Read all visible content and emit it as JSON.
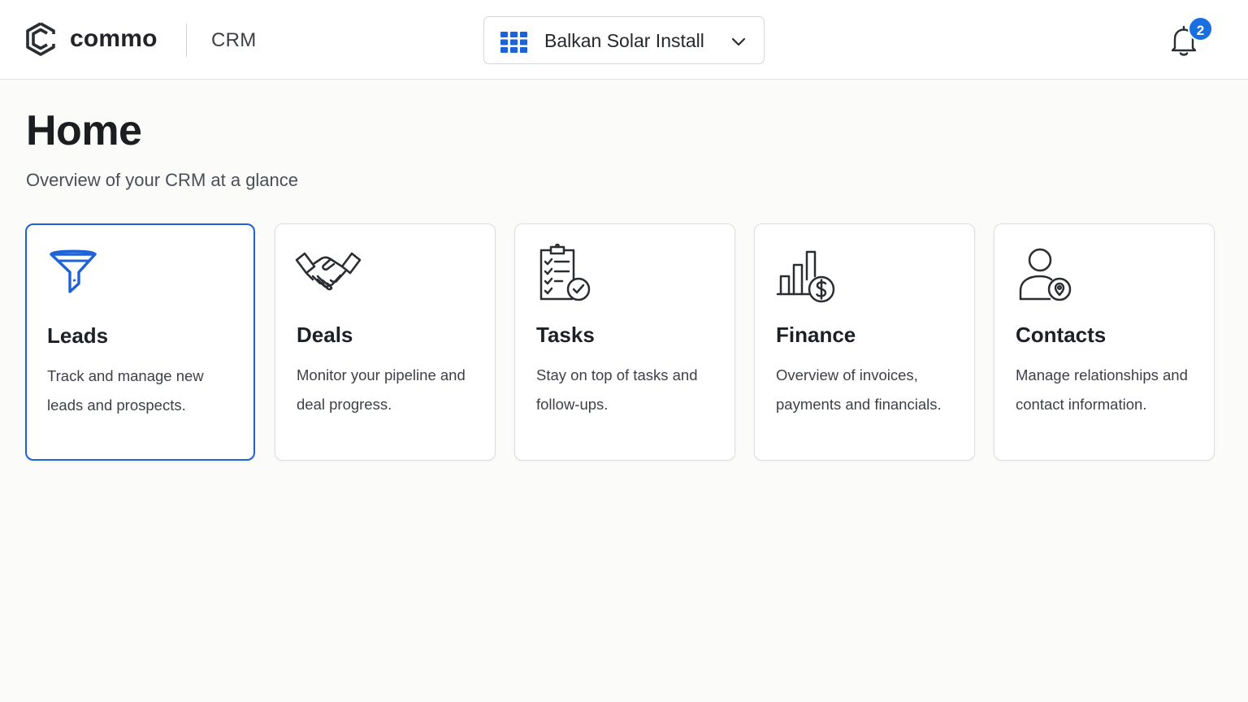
{
  "header": {
    "brand_name": "commo",
    "product_label": "CRM",
    "workspace": {
      "selected": "Balkan Solar Install",
      "icon": "grid-icon",
      "dropdown_icon": "chevron-down-icon"
    },
    "notifications": {
      "icon": "bell-icon",
      "count": "2"
    }
  },
  "main": {
    "title": "Home",
    "subtitle": "Overview of your CRM at a glance",
    "cards": [
      {
        "icon": "funnel-icon",
        "title": "Leads",
        "description": "Track and manage new leads and prospects.",
        "selected": true
      },
      {
        "icon": "handshake-icon",
        "title": "Deals",
        "description": "Monitor your pipeline and deal progress.",
        "selected": false
      },
      {
        "icon": "clipboard-check-icon",
        "title": "Tasks",
        "description": "Stay on top of tasks and follow-ups.",
        "selected": false
      },
      {
        "icon": "finance-chart-icon",
        "title": "Finance",
        "description": "Overview of invoices, payments and financials.",
        "selected": false
      },
      {
        "icon": "contact-icon",
        "title": "Contacts",
        "description": "Manage relationships and contact information.",
        "selected": false
      }
    ]
  },
  "colors": {
    "accent": "#1f62d6",
    "badge": "#1a6fe0",
    "background": "#fbfbfa",
    "card_border": "#dcdee1"
  }
}
